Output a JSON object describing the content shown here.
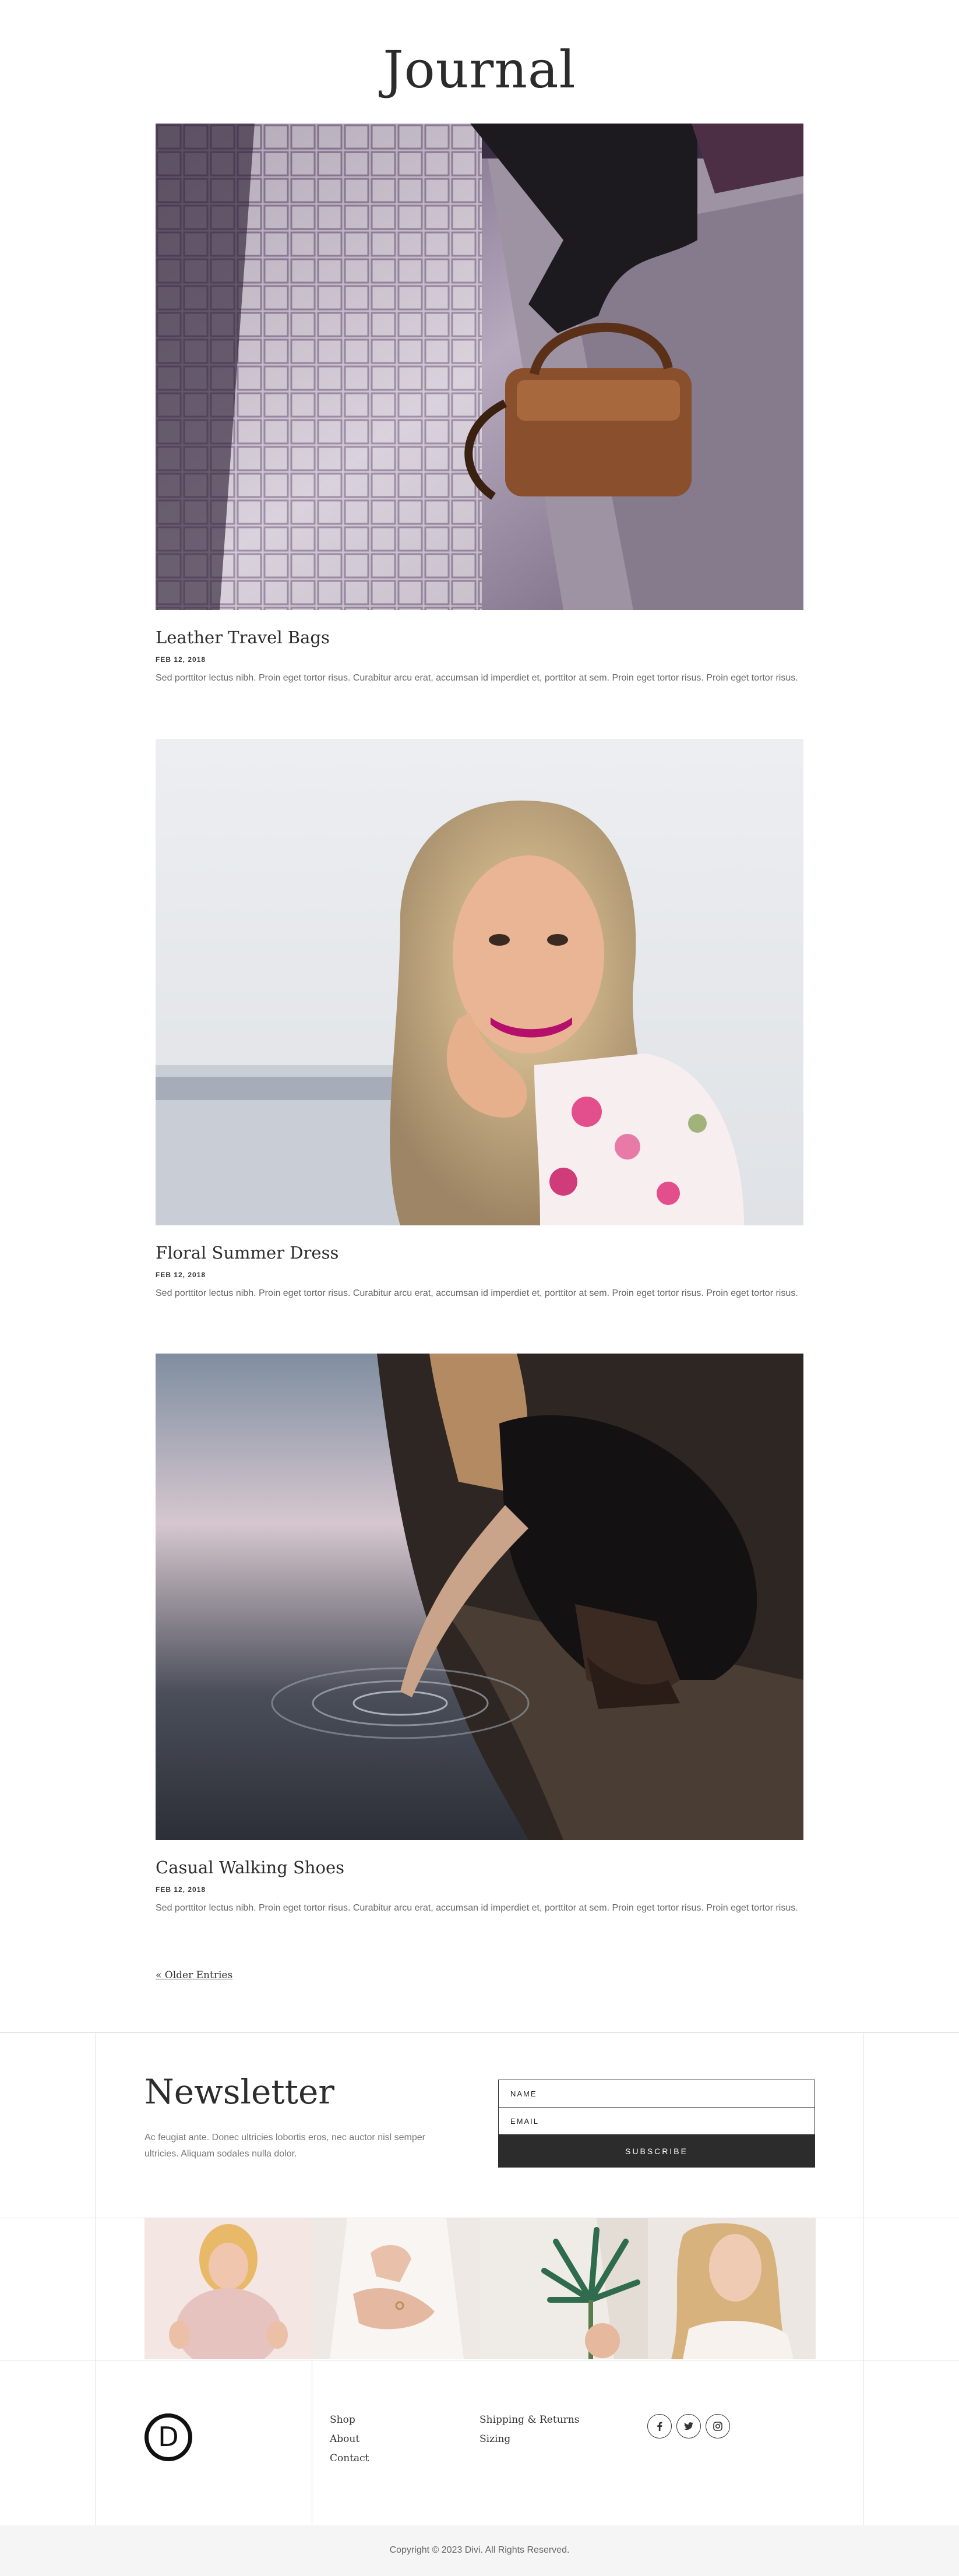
{
  "page": {
    "title": "Journal"
  },
  "posts": [
    {
      "title": "Leather Travel Bags",
      "date": "FEB 12, 2018",
      "excerpt": "Sed porttitor lectus nibh. Proin eget tortor risus. Curabitur arcu erat, accumsan id imperdiet et, porttitor at sem. Proin eget tortor risus. Proin eget tortor risus."
    },
    {
      "title": "Floral Summer Dress",
      "date": "FEB 12, 2018",
      "excerpt": "Sed porttitor lectus nibh. Proin eget tortor risus. Curabitur arcu erat, accumsan id imperdiet et, porttitor at sem. Proin eget tortor risus. Proin eget tortor risus."
    },
    {
      "title": "Casual Walking Shoes",
      "date": "FEB 12, 2018",
      "excerpt": "Sed porttitor lectus nibh. Proin eget tortor risus. Curabitur arcu erat, accumsan id imperdiet et, porttitor at sem. Proin eget tortor risus. Proin eget tortor risus."
    }
  ],
  "pagination": {
    "older": "« Older Entries"
  },
  "newsletter": {
    "title": "Newsletter",
    "text": "Ac feugiat ante. Donec ultricies lobortis eros, nec auctor nisl semper ultricies. Aliquam sodales nulla dolor.",
    "name_placeholder": "NAME",
    "email_placeholder": "EMAIL",
    "button": "SUBSCRIBE"
  },
  "footer": {
    "logo_letter": "D",
    "col1": [
      "Shop",
      "About",
      "Contact"
    ],
    "col2": [
      "Shipping & Returns",
      "Sizing"
    ],
    "social": [
      "facebook-icon",
      "twitter-icon",
      "instagram-icon"
    ],
    "copyright": "Copyright © 2023 Divi. All Rights Reserved."
  },
  "colors": {
    "dark": "#2c2c2c",
    "muted": "#666666",
    "line": "#dcdcdc"
  }
}
